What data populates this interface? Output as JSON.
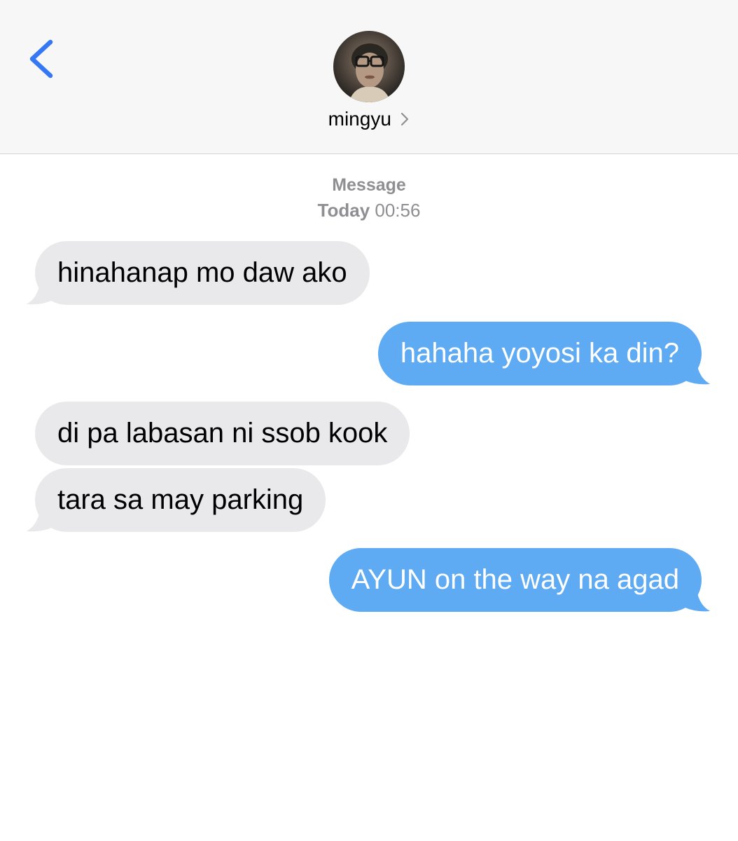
{
  "contact": {
    "name": "mingyu"
  },
  "header_meta": {
    "service": "Message",
    "day": "Today",
    "time": "00:56"
  },
  "messages": [
    {
      "direction": "incoming",
      "text": "hinahanap mo daw ako"
    },
    {
      "direction": "outgoing",
      "text": "hahaha yoyosi ka din?"
    },
    {
      "direction": "incoming",
      "text": "di pa labasan ni ssob kook"
    },
    {
      "direction": "incoming",
      "text": "tara sa may parking"
    },
    {
      "direction": "outgoing",
      "text": "AYUN on the way na agad"
    }
  ],
  "colors": {
    "accent": "#3478f6",
    "incoming_bubble": "#e9e9eb",
    "outgoing_bubble": "#5eaaf3",
    "meta_text": "#8e8e93"
  },
  "icons": {
    "back": "chevron-left-icon",
    "contact_detail": "chevron-right-icon"
  }
}
